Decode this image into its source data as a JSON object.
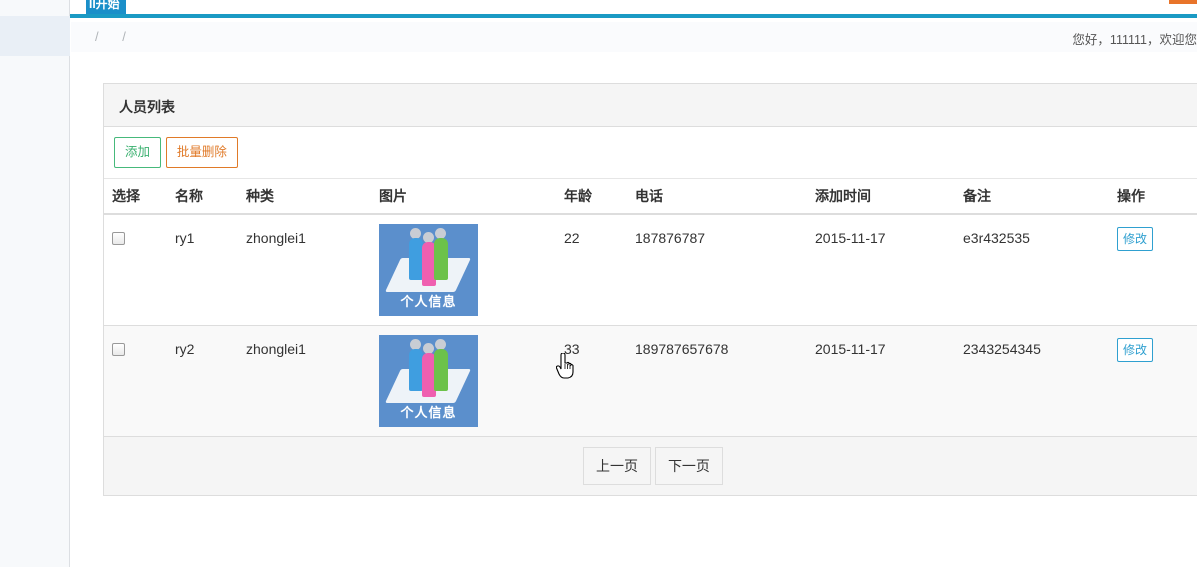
{
  "topbar": {
    "tab_label": "II开始"
  },
  "breadcrumb": {
    "separators": [
      "/",
      "/"
    ]
  },
  "greeting": "您好，111111，欢迎您",
  "panel": {
    "title": "人员列表",
    "add_label": "添加",
    "batch_delete_label": "批量删除"
  },
  "table": {
    "headers": [
      "选择",
      "名称",
      "种类",
      "图片",
      "年龄",
      "电话",
      "添加时间",
      "备注",
      "操作"
    ],
    "rows": [
      {
        "name": "ry1",
        "category": "zhonglei1",
        "image_caption": "个人信息",
        "age": "22",
        "phone": "187876787",
        "added": "2015-11-17",
        "note": "e3r432535",
        "edit_label": "修改"
      },
      {
        "name": "ry2",
        "category": "zhonglei1",
        "image_caption": "个人信息",
        "age": "33",
        "phone": "189787657678",
        "added": "2015-11-17",
        "note": "2343254345",
        "edit_label": "修改"
      }
    ]
  },
  "pagination": {
    "prev_label": "上一页",
    "next_label": "下一页"
  },
  "colors": {
    "accent_blue": "#1a9ac4",
    "add_green": "#46b97b",
    "delete_orange": "#e07a28",
    "edit_blue": "#2fa0d0"
  },
  "icons": {
    "image": "personal-info-icon",
    "cursor": "hand-pointer-cursor-icon"
  }
}
